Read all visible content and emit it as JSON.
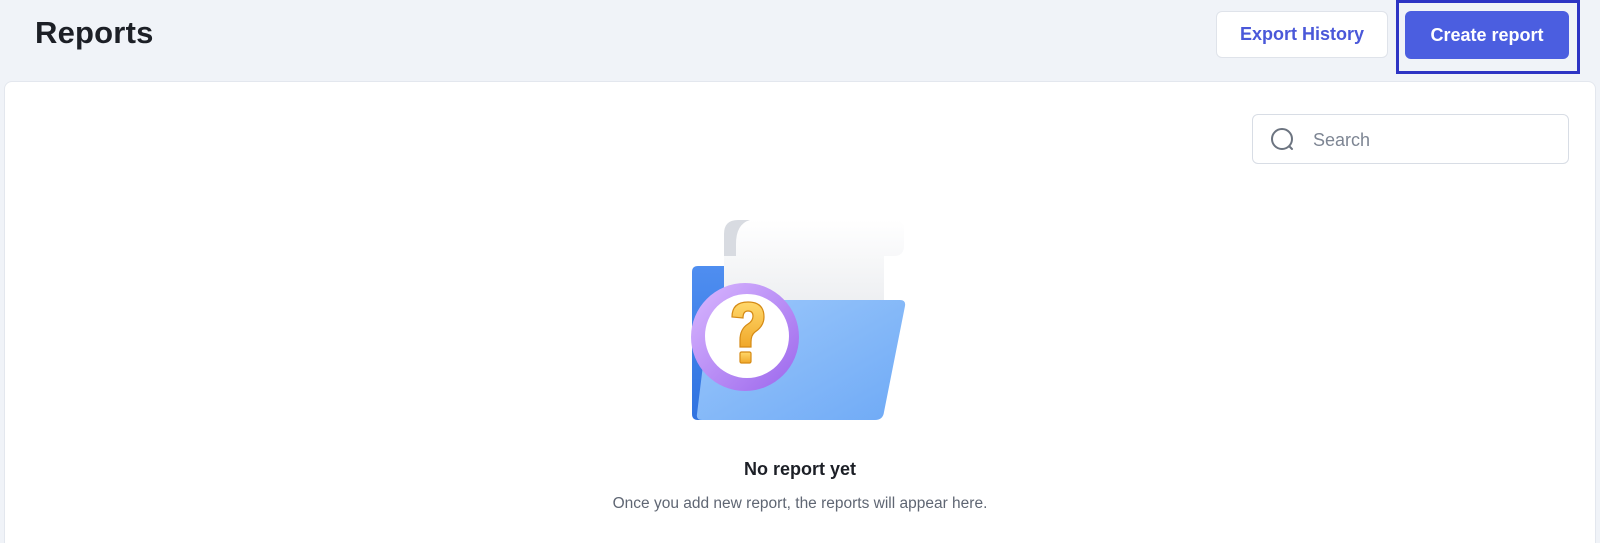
{
  "header": {
    "title": "Reports",
    "export_history_label": "Export History",
    "create_report_label": "Create report"
  },
  "search": {
    "placeholder": "Search",
    "value": ""
  },
  "empty_state": {
    "illustration": "folder-question-icon",
    "title": "No report yet",
    "description": "Once you add new report, the reports will appear here."
  },
  "colors": {
    "accent": "#4b5ee0",
    "accent_text": "#4a58d9",
    "highlight_border": "#2d34c4",
    "background": "#f0f3f8"
  }
}
